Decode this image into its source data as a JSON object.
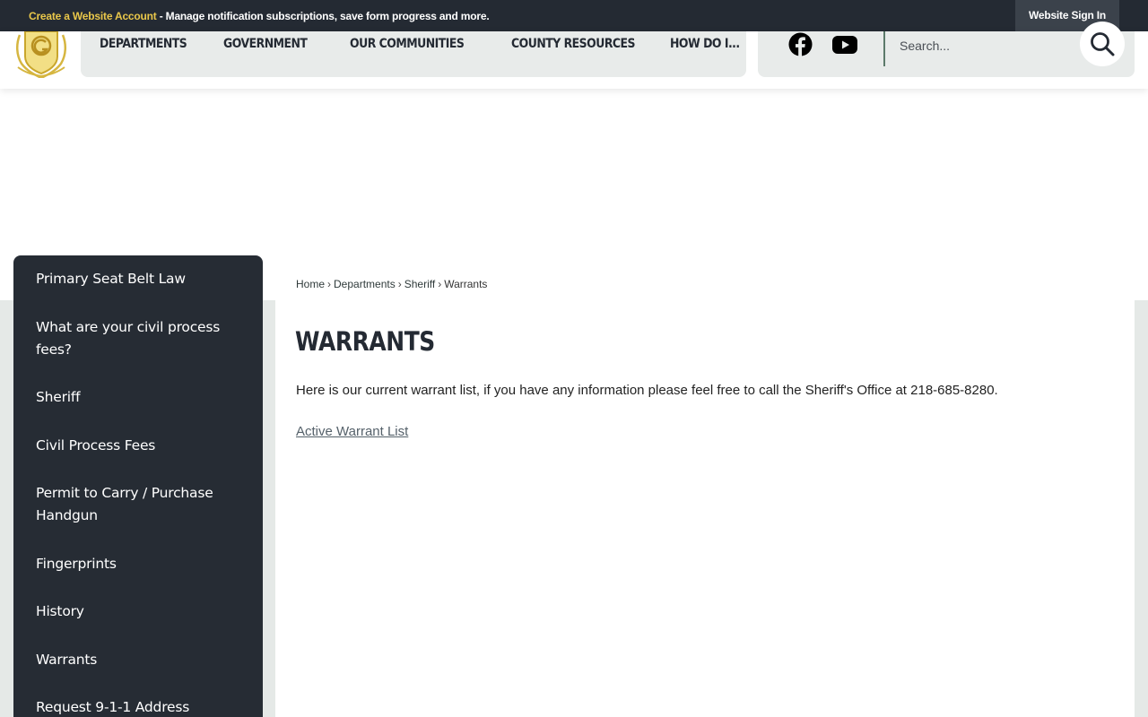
{
  "topbar": {
    "create_account_link": "Create a Website Account",
    "message": " - Manage notification subscriptions, save form progress and more.",
    "sign_in": "Website Sign In"
  },
  "header": {
    "nav": [
      "DEPARTMENTS",
      "GOVERNMENT",
      "OUR COMMUNITIES",
      "COUNTY RESOURCES",
      "HOW DO I..."
    ],
    "search": {
      "placeholder": "Search..."
    },
    "social_icons": [
      "facebook-icon",
      "youtube-icon"
    ]
  },
  "sidebar": {
    "items": [
      "Primary Seat Belt Law",
      "What are your civil process fees?",
      "Sheriff",
      "Civil Process Fees",
      "Permit to Carry / Purchase Handgun",
      "Fingerprints",
      "History",
      "Warrants",
      "Request 9-1-1 Address"
    ]
  },
  "breadcrumb": {
    "items": [
      "Home",
      "Departments",
      "Sheriff",
      "Warrants"
    ],
    "separator": "›"
  },
  "main": {
    "title": "WARRANTS",
    "intro": "Here is our current warrant list, if you have any information please feel free to call the Sheriff's Office at 218-685-8280.",
    "link": "Active Warrant List"
  },
  "colors": {
    "topbar_bg": "#242a33",
    "accent_yellow": "#e9c74a",
    "nav_bg": "#e8ebea",
    "sidebar_bg": "#262c34"
  }
}
